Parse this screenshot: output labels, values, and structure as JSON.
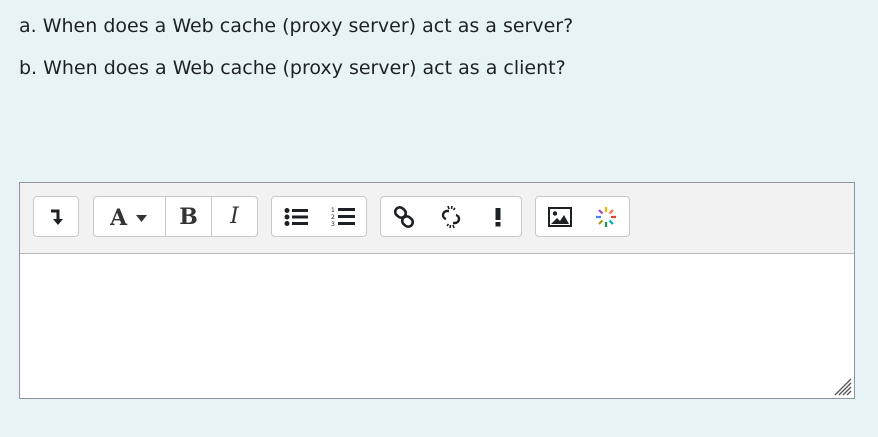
{
  "questions": {
    "a": "a. When does a Web cache (proxy server) act as a server?",
    "b": "b. When does a Web cache (proxy server) act as a client?"
  },
  "toolbar": {
    "bold_label": "B",
    "italic_label": "I",
    "icons": [
      "collapse-icon",
      "font-style-icon",
      "bold-icon",
      "italic-icon",
      "unordered-list-icon",
      "ordered-list-icon",
      "link-icon",
      "unlink-icon",
      "exclamation-icon",
      "image-icon",
      "media-sparkle-icon"
    ]
  },
  "editor": {
    "content": ""
  }
}
